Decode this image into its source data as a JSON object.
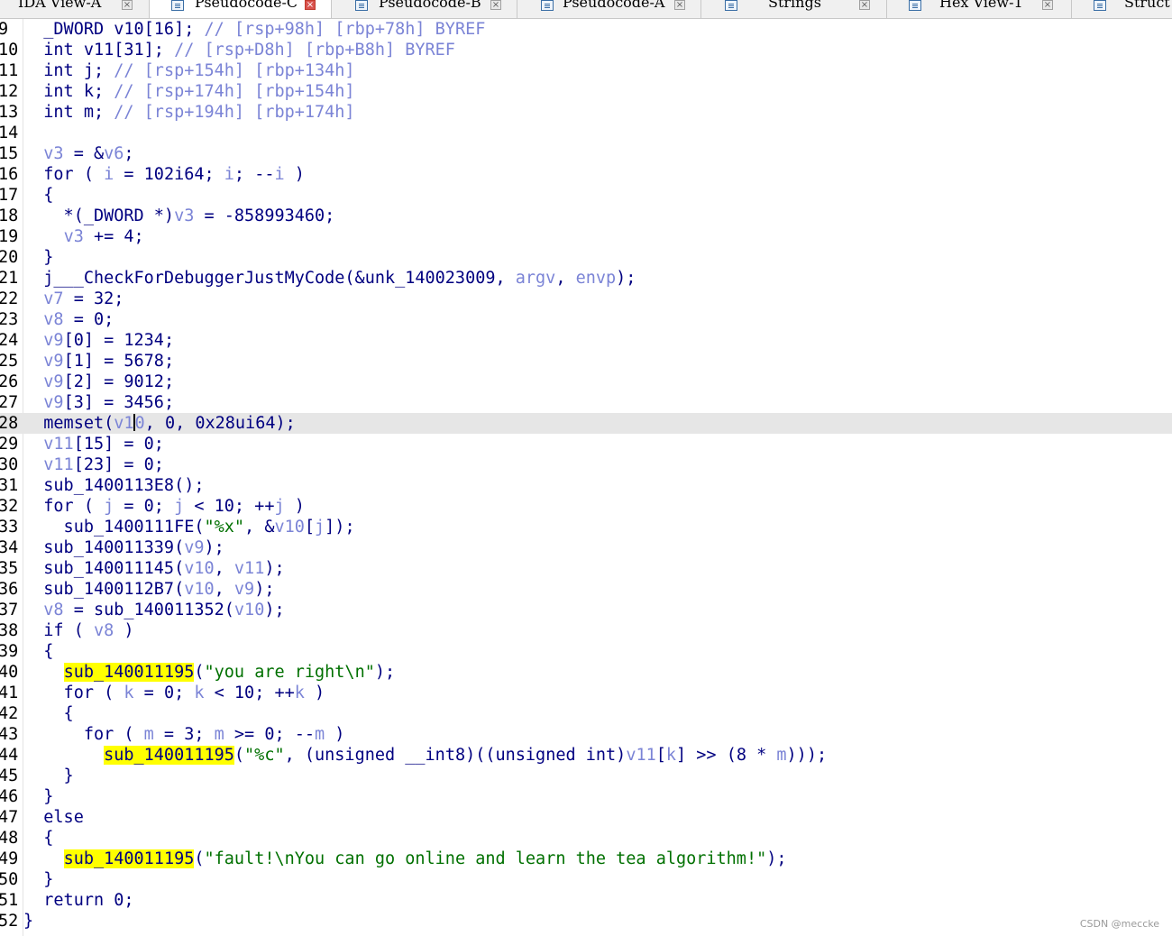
{
  "tabs": [
    {
      "label": "IDA View-A",
      "icon": "ida-view-icon",
      "active": false
    },
    {
      "label": "Pseudocode-C",
      "icon": "pseudocode-icon",
      "active": true
    },
    {
      "label": "Pseudocode-B",
      "icon": "pseudocode-icon",
      "active": false
    },
    {
      "label": "Pseudocode-A",
      "icon": "pseudocode-icon",
      "active": false
    },
    {
      "label": "Strings",
      "icon": "strings-icon",
      "active": false
    },
    {
      "label": "Hex View-1",
      "icon": "hex-view-icon",
      "active": false
    },
    {
      "label": "Struct",
      "icon": "structures-icon",
      "active": false
    }
  ],
  "editor": {
    "current_line": "28",
    "lines": [
      {
        "n": "9",
        "t": [
          [
            "  ",
            ""
          ],
          [
            "_DWORD",
            "kw"
          ],
          [
            " v10[16]; ",
            ""
          ],
          [
            "// [rsp+98h] [rbp+78h] BYREF",
            "cmt"
          ]
        ]
      },
      {
        "n": "10",
        "t": [
          [
            "  int ",
            ""
          ],
          [
            "v11",
            "kw"
          ],
          [
            "[31]; ",
            ""
          ],
          [
            "// [rsp+D8h] [rbp+B8h] BYREF",
            "cmt"
          ]
        ]
      },
      {
        "n": "11",
        "t": [
          [
            "  int j; ",
            ""
          ],
          [
            "// [rsp+154h] [rbp+134h]",
            "cmt"
          ]
        ]
      },
      {
        "n": "12",
        "t": [
          [
            "  int k; ",
            ""
          ],
          [
            "// [rsp+174h] [rbp+154h]",
            "cmt"
          ]
        ]
      },
      {
        "n": "13",
        "t": [
          [
            "  int m; ",
            ""
          ],
          [
            "// [rsp+194h] [rbp+174h]",
            "cmt"
          ]
        ]
      },
      {
        "n": "14",
        "t": []
      },
      {
        "n": "15",
        "t": [
          [
            "  ",
            ""
          ],
          [
            "v3",
            "var"
          ],
          [
            " = &",
            ""
          ],
          [
            "v6",
            "var"
          ],
          [
            ";",
            ""
          ]
        ]
      },
      {
        "n": "16",
        "t": [
          [
            "  for ( ",
            ""
          ],
          [
            "i",
            "var"
          ],
          [
            " = 102i64; ",
            ""
          ],
          [
            "i",
            "var"
          ],
          [
            "; --",
            ""
          ],
          [
            "i",
            "var"
          ],
          [
            " )",
            ""
          ]
        ]
      },
      {
        "n": "17",
        "t": [
          [
            "  {",
            ""
          ]
        ]
      },
      {
        "n": "18",
        "t": [
          [
            "    *(_DWORD *)",
            ""
          ],
          [
            "v3",
            "var"
          ],
          [
            " = -858993460;",
            ""
          ]
        ]
      },
      {
        "n": "19",
        "t": [
          [
            "    ",
            ""
          ],
          [
            "v3",
            "var"
          ],
          [
            " += 4;",
            ""
          ]
        ]
      },
      {
        "n": "20",
        "t": [
          [
            "  }",
            ""
          ]
        ]
      },
      {
        "n": "21",
        "t": [
          [
            "  j___CheckForDebuggerJustMyCode(&unk_140023009, ",
            ""
          ],
          [
            "argv",
            "var"
          ],
          [
            ", ",
            ""
          ],
          [
            "envp",
            "var"
          ],
          [
            ");",
            ""
          ]
        ]
      },
      {
        "n": "22",
        "t": [
          [
            "  ",
            ""
          ],
          [
            "v7",
            "var"
          ],
          [
            " = 32;",
            ""
          ]
        ]
      },
      {
        "n": "23",
        "t": [
          [
            "  ",
            ""
          ],
          [
            "v8",
            "var"
          ],
          [
            " = 0;",
            ""
          ]
        ]
      },
      {
        "n": "24",
        "t": [
          [
            "  ",
            ""
          ],
          [
            "v9",
            "var"
          ],
          [
            "[0] = 1234;",
            ""
          ]
        ]
      },
      {
        "n": "25",
        "t": [
          [
            "  ",
            ""
          ],
          [
            "v9",
            "var"
          ],
          [
            "[1] = 5678;",
            ""
          ]
        ]
      },
      {
        "n": "26",
        "t": [
          [
            "  ",
            ""
          ],
          [
            "v9",
            "var"
          ],
          [
            "[2] = 9012;",
            ""
          ]
        ]
      },
      {
        "n": "27",
        "t": [
          [
            "  ",
            ""
          ],
          [
            "v9",
            "var"
          ],
          [
            "[3] = 3456;",
            ""
          ]
        ]
      },
      {
        "n": "28",
        "t": [
          [
            "  memset(",
            ""
          ],
          [
            "v1",
            "var"
          ],
          [
            "|",
            ""
          ],
          [
            "0",
            "var"
          ],
          [
            ", 0, 0x28ui64);",
            ""
          ]
        ]
      },
      {
        "n": "29",
        "t": [
          [
            "  ",
            ""
          ],
          [
            "v11",
            "var"
          ],
          [
            "[15] = 0;",
            ""
          ]
        ]
      },
      {
        "n": "30",
        "t": [
          [
            "  ",
            ""
          ],
          [
            "v11",
            "var"
          ],
          [
            "[23] = 0;",
            ""
          ]
        ]
      },
      {
        "n": "31",
        "t": [
          [
            "  sub_1400113E8();",
            ""
          ]
        ]
      },
      {
        "n": "32",
        "t": [
          [
            "  for ( ",
            ""
          ],
          [
            "j",
            "var"
          ],
          [
            " = 0; ",
            ""
          ],
          [
            "j",
            "var"
          ],
          [
            " < 10; ++",
            ""
          ],
          [
            "j",
            "var"
          ],
          [
            " )",
            ""
          ]
        ]
      },
      {
        "n": "33",
        "t": [
          [
            "    sub_1400111FE(",
            ""
          ],
          [
            "\"%x\"",
            "str"
          ],
          [
            ", &",
            ""
          ],
          [
            "v10",
            "var"
          ],
          [
            "[",
            ""
          ],
          [
            "j",
            "var"
          ],
          [
            "]);",
            ""
          ]
        ]
      },
      {
        "n": "34",
        "t": [
          [
            "  sub_140011339(",
            ""
          ],
          [
            "v9",
            "var"
          ],
          [
            ");",
            ""
          ]
        ]
      },
      {
        "n": "35",
        "t": [
          [
            "  sub_140011145(",
            ""
          ],
          [
            "v10",
            "var"
          ],
          [
            ", ",
            ""
          ],
          [
            "v11",
            "var"
          ],
          [
            ");",
            ""
          ]
        ]
      },
      {
        "n": "36",
        "t": [
          [
            "  sub_1400112B7(",
            ""
          ],
          [
            "v10",
            "var"
          ],
          [
            ", ",
            ""
          ],
          [
            "v9",
            "var"
          ],
          [
            ");",
            ""
          ]
        ]
      },
      {
        "n": "37",
        "t": [
          [
            "  ",
            ""
          ],
          [
            "v8",
            "var"
          ],
          [
            " = sub_140011352(",
            ""
          ],
          [
            "v10",
            "var"
          ],
          [
            ");",
            ""
          ]
        ]
      },
      {
        "n": "38",
        "t": [
          [
            "  if ( ",
            ""
          ],
          [
            "v8",
            "var"
          ],
          [
            " )",
            ""
          ]
        ]
      },
      {
        "n": "39",
        "t": [
          [
            "  {",
            ""
          ]
        ]
      },
      {
        "n": "40",
        "t": [
          [
            "    ",
            ""
          ],
          [
            "sub_140011195",
            "hl"
          ],
          [
            "(",
            ""
          ],
          [
            "\"you are right\\n\"",
            "str"
          ],
          [
            ");",
            ""
          ]
        ]
      },
      {
        "n": "41",
        "t": [
          [
            "    for ( ",
            ""
          ],
          [
            "k",
            "var"
          ],
          [
            " = 0; ",
            ""
          ],
          [
            "k",
            "var"
          ],
          [
            " < 10; ++",
            ""
          ],
          [
            "k",
            "var"
          ],
          [
            " )",
            ""
          ]
        ]
      },
      {
        "n": "42",
        "t": [
          [
            "    {",
            ""
          ]
        ]
      },
      {
        "n": "43",
        "t": [
          [
            "      for ( ",
            ""
          ],
          [
            "m",
            "var"
          ],
          [
            " = 3; ",
            ""
          ],
          [
            "m",
            "var"
          ],
          [
            " >= 0; --",
            ""
          ],
          [
            "m",
            "var"
          ],
          [
            " )",
            ""
          ]
        ]
      },
      {
        "n": "44",
        "t": [
          [
            "        ",
            ""
          ],
          [
            "sub_140011195",
            "hl"
          ],
          [
            "(",
            ""
          ],
          [
            "\"%c\"",
            "str"
          ],
          [
            ", (unsigned __int8)((unsigned int)",
            ""
          ],
          [
            "v11",
            "var"
          ],
          [
            "[",
            ""
          ],
          [
            "k",
            "var"
          ],
          [
            "] >> (8 * ",
            ""
          ],
          [
            "m",
            "var"
          ],
          [
            ")));",
            ""
          ]
        ]
      },
      {
        "n": "45",
        "t": [
          [
            "    }",
            ""
          ]
        ]
      },
      {
        "n": "46",
        "t": [
          [
            "  }",
            ""
          ]
        ]
      },
      {
        "n": "47",
        "t": [
          [
            "  else",
            ""
          ]
        ]
      },
      {
        "n": "48",
        "t": [
          [
            "  {",
            ""
          ]
        ]
      },
      {
        "n": "49",
        "t": [
          [
            "    ",
            ""
          ],
          [
            "sub_140011195",
            "hl"
          ],
          [
            "(",
            ""
          ],
          [
            "\"fault!\\nYou can go online and learn the tea algorithm!\"",
            "str"
          ],
          [
            ");",
            ""
          ]
        ]
      },
      {
        "n": "50",
        "t": [
          [
            "  }",
            ""
          ]
        ]
      },
      {
        "n": "51",
        "t": [
          [
            "  return 0;",
            ""
          ]
        ]
      },
      {
        "n": "52",
        "t": [
          [
            "}",
            ""
          ]
        ]
      }
    ]
  },
  "watermark": "CSDN @meccke"
}
